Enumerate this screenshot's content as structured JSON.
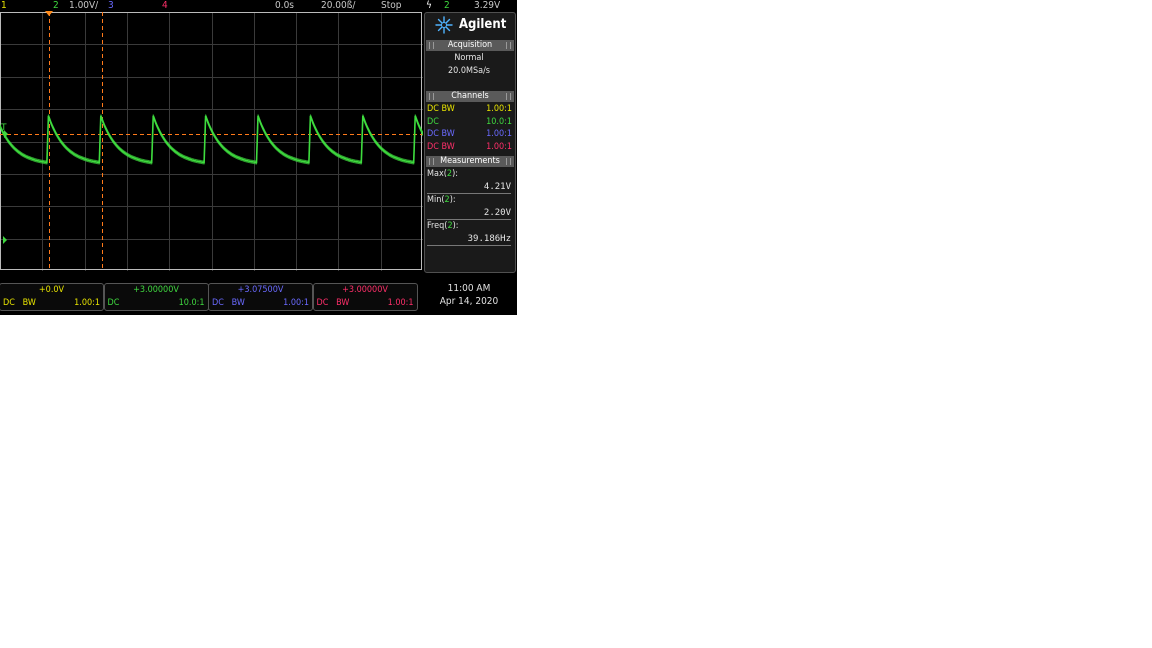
{
  "topbar": {
    "ch1": "1",
    "ch2": "2",
    "scale": "1.00V/",
    "ch3": "3",
    "ch4": "4",
    "time_offset": "0.0s",
    "time_scale": "20.00ß/",
    "run_state": "Stop",
    "trigger_symbol": "⸗",
    "trigger_channel": "2",
    "trigger_level": "3.29V"
  },
  "brand": {
    "name": "Agilent",
    "icon": "agilent-spark-icon"
  },
  "acquisition": {
    "title": "Acquisition",
    "mode": "Normal",
    "rate": "20.0MSa/s"
  },
  "channels": {
    "title": "Channels",
    "rows": [
      {
        "coupling": "DC BW",
        "probe": "1.00:1",
        "color": "#e8e400"
      },
      {
        "coupling": "DC",
        "probe": "10.0:1",
        "color": "#3fd83f"
      },
      {
        "coupling": "DC BW",
        "probe": "1.00:1",
        "color": "#6a6aff"
      },
      {
        "coupling": "DC BW",
        "probe": "1.00:1",
        "color": "#ff2f6a"
      }
    ]
  },
  "measurements": {
    "title": "Measurements",
    "items": [
      {
        "label": "Max",
        "src": "2",
        "value": "4.21V"
      },
      {
        "label": "Min",
        "src": "2",
        "value": "2.20V"
      },
      {
        "label": "Freq",
        "src": "2",
        "value": "39.186Hz"
      }
    ]
  },
  "bottom_channels": [
    {
      "offset": "+0.0V",
      "left": "DC   BW",
      "probe": "1.00:1",
      "color": "#e8e400"
    },
    {
      "offset": "+3.00000V",
      "left": "DC",
      "probe": "10.0:1",
      "color": "#3fd83f"
    },
    {
      "offset": "+3.07500V",
      "left": "DC   BW",
      "probe": "1.00:1",
      "color": "#6a6aff"
    },
    {
      "offset": "+3.00000V",
      "left": "DC   BW",
      "probe": "1.00:1",
      "color": "#ff2f6a"
    }
  ],
  "clock": {
    "time": "11:00 AM",
    "date": "Apr 14, 2020"
  },
  "markers": {
    "trigger_marker": "T"
  },
  "colors": {
    "trace": "#3fdc3f",
    "cursor": "#ff7a1a",
    "grid": "#3a3a3a"
  }
}
